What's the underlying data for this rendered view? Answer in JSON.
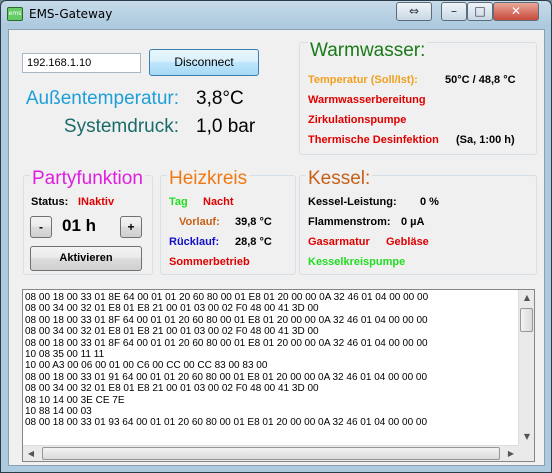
{
  "window": {
    "title": "EMS-Gateway",
    "icon_text": "ems",
    "buttons": {
      "special": "⇔",
      "minimize": "–",
      "maximize": "□",
      "close": "✕"
    }
  },
  "connection": {
    "ip_value": "192.168.1.10",
    "disconnect_label": "Disconnect"
  },
  "overview": {
    "aussentemperatur_label": "Außentemperatur:",
    "aussentemperatur_value": "3,8°C",
    "systemdruck_label": "Systemdruck:",
    "systemdruck_value": "1,0 bar"
  },
  "warmwasser": {
    "title": "Warmwasser:",
    "temperatur_label": "Temperatur (Soll/Ist):",
    "temperatur_value": "50°C / 48,8 °C",
    "bereitung": "Warmwasserbereitung",
    "zirkulation": "Zirkulationspumpe",
    "desinfektion": "Thermische Desinfektion",
    "desinfektion_time": "(Sa, 1:00 h)"
  },
  "partyfunktion": {
    "title": "Partyfunktion",
    "status_label": "Status:",
    "status_value": "INaktiv",
    "minus": "-",
    "hours": "01 h",
    "plus": "+",
    "activate_label": "Aktivieren"
  },
  "heizkreis": {
    "title": "Heizkreis",
    "tag": "Tag",
    "nacht": "Nacht",
    "vorlauf_label": "Vorlauf:",
    "vorlauf_value": "39,8 °C",
    "ruecklauf_label": "Rücklauf:",
    "ruecklauf_value": "28,8 °C",
    "sommerbetrieb": "Sommerbetrieb"
  },
  "kessel": {
    "title": "Kessel:",
    "leistung_label": "Kessel-Leistung:",
    "leistung_value": "0 %",
    "flammenstrom_label": "Flammenstrom:",
    "flammenstrom_value": "0 µA",
    "gasarmatur": "Gasarmatur",
    "geblaese": "Gebläse",
    "kesselkreispumpe": "Kesselkreispumpe"
  },
  "log_lines": [
    "08 00 18 00 33 01 8E 64 00 01 01 20 60 80 00 01 E8 01 20 00 00 0A 32 46 01 04 00 00 00",
    "08 00 34 00 32 01 E8 01 E8 21 00 01 03 00 02 F0 48 00 41 3D 00",
    "08 00 18 00 33 01 8F 64 00 01 01 20 60 80 00 01 E8 01 20 00 00 0A 32 46 01 04 00 00 00",
    "08 00 34 00 32 01 E8 01 E8 21 00 01 03 00 02 F0 48 00 41 3D 00",
    "08 00 18 00 33 01 8F 64 00 01 01 20 60 80 00 01 E8 01 20 00 00 0A 32 46 01 04 00 00 00",
    "10 08 35 00 11 11",
    "10 00 A3 00 06 00 01 00 C6 00 CC 00 CC 83 00 83 00",
    "08 00 18 00 33 01 91 64 00 01 01 20 60 80 00 01 E8 01 20 00 00 0A 32 46 01 04 00 00 00",
    "08 00 34 00 32 01 E8 01 E8 21 00 01 03 00 02 F0 48 00 41 3D 00",
    "08 10 14 00 3E CE 7E",
    "10 88 14 00 03",
    "08 00 18 00 33 01 93 64 00 01 01 20 60 80 00 01 E8 01 20 00 00 0A 32 46 01 04 00 00 00"
  ],
  "colors": {
    "cyan": "#1e9fd8",
    "teal": "#1b6b6b",
    "green": "#1a7a1a",
    "orange": "#f0a020",
    "red": "#e00000",
    "magenta": "#e01ee0",
    "bright_green": "#22dd22",
    "blue": "#1010c8"
  }
}
